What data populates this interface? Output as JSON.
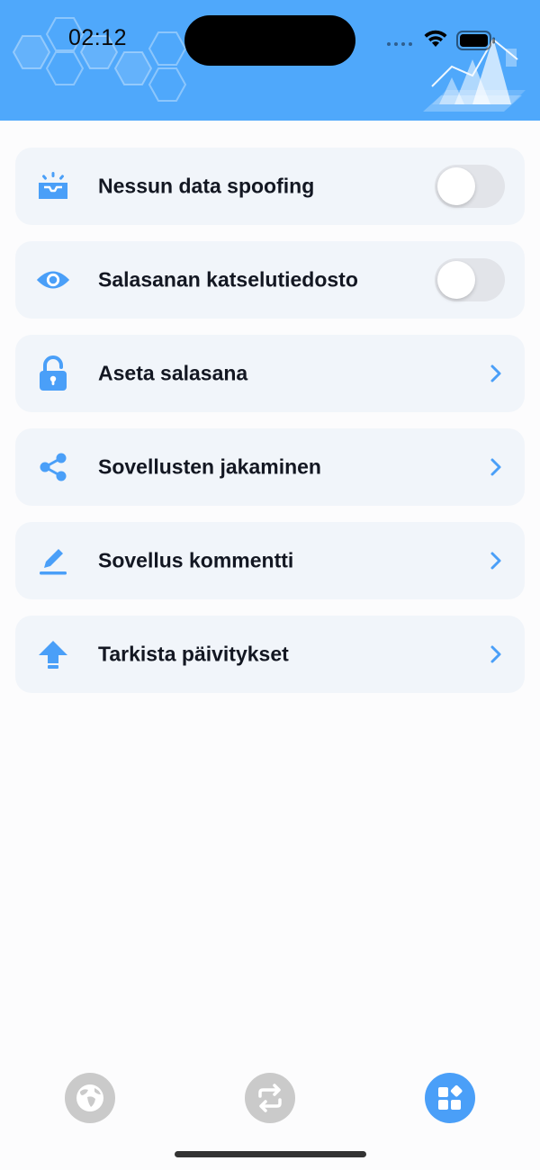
{
  "status_bar": {
    "time": "02:12"
  },
  "theme": {
    "header_color": "#4fa8fb",
    "accent": "#4a9ff8",
    "row_background": "#f1f5fa",
    "inactive_tab": "#cacaca"
  },
  "settings": {
    "items": [
      {
        "label": "Nessun data spoofing",
        "icon": "inbox-tray-icon",
        "control": "toggle",
        "enabled": false
      },
      {
        "label": "Salasanan katselutiedosto",
        "icon": "eye-icon",
        "control": "toggle",
        "enabled": false
      },
      {
        "label": "Aseta salasana",
        "icon": "unlock-icon",
        "control": "chevron"
      },
      {
        "label": "Sovellusten jakaminen",
        "icon": "share-icon",
        "control": "chevron"
      },
      {
        "label": "Sovellus kommentti",
        "icon": "pencil-icon",
        "control": "chevron"
      },
      {
        "label": "Tarkista päivitykset",
        "icon": "upload-arrow-icon",
        "control": "chevron"
      }
    ]
  },
  "tab_bar": {
    "tabs": [
      {
        "icon": "globe-icon",
        "active": false
      },
      {
        "icon": "swap-arrows-icon",
        "active": false
      },
      {
        "icon": "apps-grid-icon",
        "active": true
      }
    ]
  }
}
